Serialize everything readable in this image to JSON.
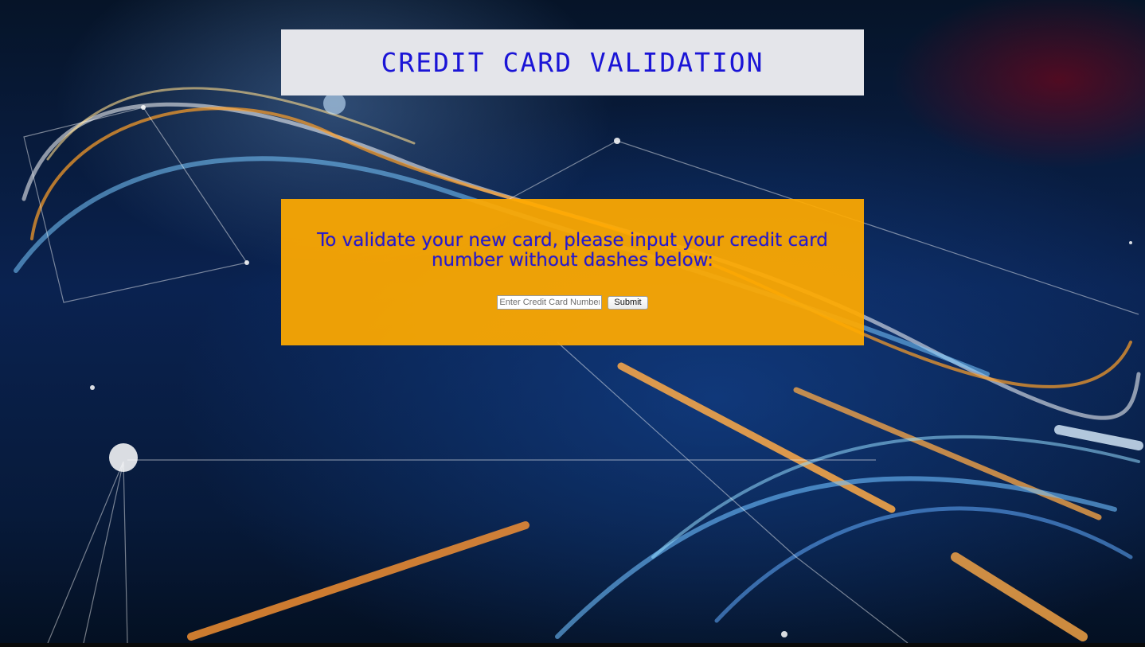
{
  "header": {
    "title": "CREDIT CARD VALIDATION"
  },
  "panel": {
    "instructions": "To validate your new card, please input your credit card number without dashes below:"
  },
  "form": {
    "card_input_placeholder": "Enter Credit Card Number",
    "submit_label": "Submit"
  },
  "colors": {
    "title_color": "#1a14d6",
    "panel_bg": "#ffaa00",
    "panel_text": "#2418d4",
    "header_bg": "#e4e5ea"
  }
}
